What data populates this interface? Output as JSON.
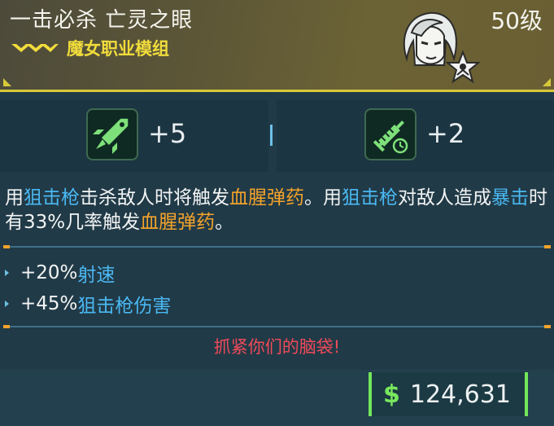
{
  "item": {
    "name": "一击必杀 亡灵之眼",
    "level": "50级",
    "class_mod": "魔女职业模组"
  },
  "stats": [
    {
      "icon": "rocket-sniper-icon",
      "value": "+5"
    },
    {
      "icon": "syringe-timer-icon",
      "value": "+2"
    }
  ],
  "description": {
    "parts": [
      {
        "text": "用",
        "style": "plain"
      },
      {
        "text": "狙击枪",
        "style": "blue"
      },
      {
        "text": "击杀敌人时将触发",
        "style": "plain"
      },
      {
        "text": "血腥弹药",
        "style": "orange"
      },
      {
        "text": "。用",
        "style": "plain"
      },
      {
        "text": "狙击枪",
        "style": "blue"
      },
      {
        "text": "对敌人造成",
        "style": "plain"
      },
      {
        "text": "暴击",
        "style": "blue"
      },
      {
        "text": "时有33%几率触发",
        "style": "plain"
      },
      {
        "text": "血腥弹药",
        "style": "orange"
      },
      {
        "text": "。",
        "style": "plain"
      }
    ]
  },
  "bonuses": [
    {
      "prefix": "+20%",
      "label": "射速"
    },
    {
      "prefix": "+45%",
      "label": "狙击枪伤害"
    }
  ],
  "flavor_text": "抓紧你们的脑袋!",
  "price": {
    "currency_symbol": "$",
    "amount": "124,631"
  },
  "colors": {
    "accent_yellow": "#d8c93a",
    "highlight_blue": "#4ab8f2",
    "highlight_orange": "#f3a32b",
    "flavor_red": "#ef4a5a",
    "money_green": "#73e65a"
  }
}
